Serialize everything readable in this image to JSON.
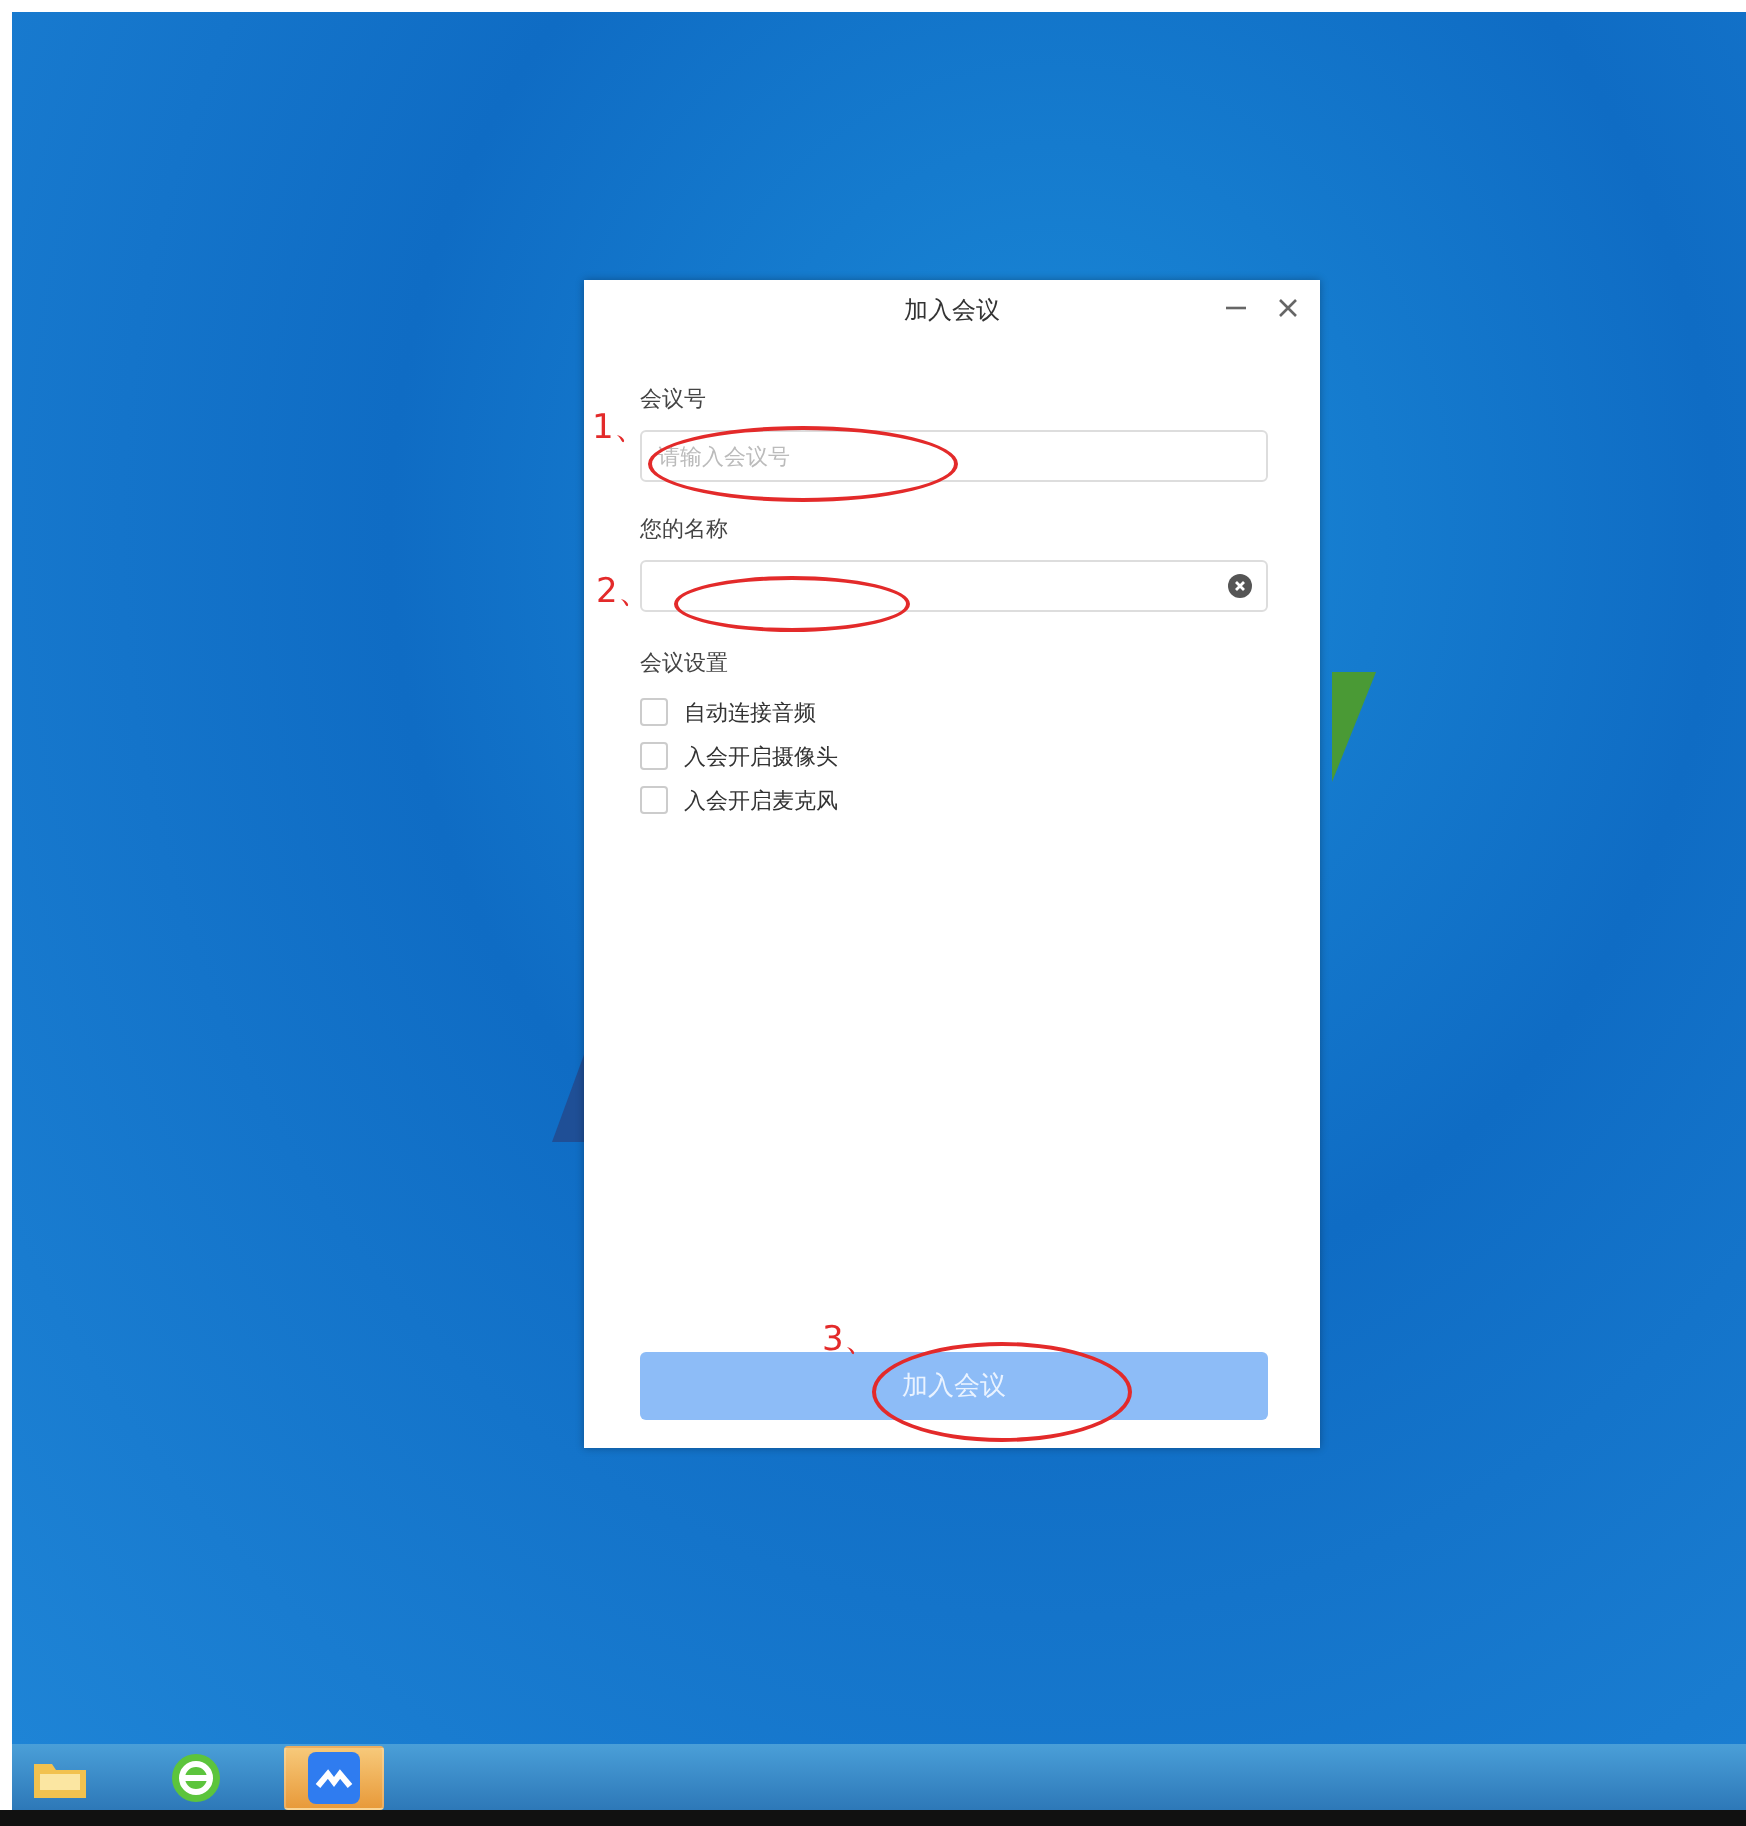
{
  "dialog": {
    "title": "加入会议",
    "fields": [
      {
        "label": "会议号",
        "placeholder": "请输入会议号",
        "clearable": false
      },
      {
        "label": "您的名称",
        "clearable": true
      }
    ],
    "settings_title": "会议设置",
    "options": [
      {
        "label": "自动连接音频",
        "checked": false
      },
      {
        "label": "入会开启摄像头",
        "checked": false
      },
      {
        "label": "入会开启麦克风",
        "checked": false
      }
    ],
    "join_button": {
      "label": "加入会议",
      "disabled": true
    }
  },
  "annotations": [
    {
      "label": "1、"
    },
    {
      "label": "2、"
    },
    {
      "label": "3、"
    }
  ],
  "taskbar": {
    "items": [
      {
        "kind": "folder",
        "selected": false
      },
      {
        "kind": "browser",
        "selected": false
      },
      {
        "kind": "meeting",
        "selected": true
      }
    ]
  }
}
